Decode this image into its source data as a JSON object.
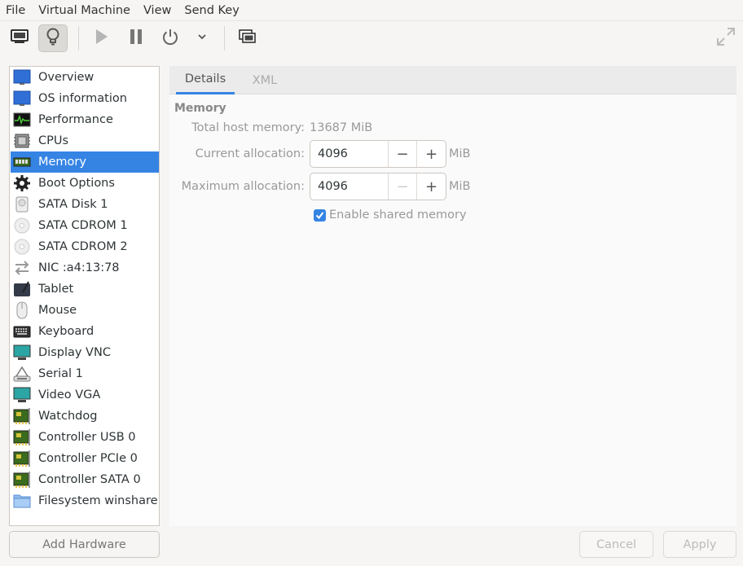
{
  "menubar": {
    "items": [
      "File",
      "Virtual Machine",
      "View",
      "Send Key"
    ]
  },
  "toolbar": {
    "console_icon": "monitor-icon",
    "details_icon": "lightbulb-icon",
    "run_icon": "play-icon",
    "pause_icon": "pause-icon",
    "shutdown_icon": "power-icon",
    "shutdown_menu_icon": "chevron-down-icon",
    "snapshots_icon": "snapshots-icon",
    "fullscreen_icon": "fullscreen-icon"
  },
  "sidebar": {
    "selected_index": 4,
    "items": [
      {
        "label": "Overview",
        "icon": "monitor-blue-icon"
      },
      {
        "label": "OS information",
        "icon": "monitor-blue-icon"
      },
      {
        "label": "Performance",
        "icon": "performance-graph-icon"
      },
      {
        "label": "CPUs",
        "icon": "cpu-chip-icon"
      },
      {
        "label": "Memory",
        "icon": "memory-module-icon"
      },
      {
        "label": "Boot Options",
        "icon": "gear-icon"
      },
      {
        "label": "SATA Disk 1",
        "icon": "hard-disk-icon"
      },
      {
        "label": "SATA CDROM 1",
        "icon": "cdrom-icon"
      },
      {
        "label": "SATA CDROM 2",
        "icon": "cdrom-icon"
      },
      {
        "label": "NIC :a4:13:78",
        "icon": "network-arrows-icon"
      },
      {
        "label": "Tablet",
        "icon": "tablet-icon"
      },
      {
        "label": "Mouse",
        "icon": "mouse-icon"
      },
      {
        "label": "Keyboard",
        "icon": "keyboard-icon"
      },
      {
        "label": "Display VNC",
        "icon": "display-icon"
      },
      {
        "label": "Serial 1",
        "icon": "serial-icon"
      },
      {
        "label": "Video VGA",
        "icon": "display-icon"
      },
      {
        "label": "Watchdog",
        "icon": "pci-card-icon"
      },
      {
        "label": "Controller USB 0",
        "icon": "pci-card-icon"
      },
      {
        "label": "Controller PCIe 0",
        "icon": "pci-card-icon"
      },
      {
        "label": "Controller SATA 0",
        "icon": "pci-card-icon"
      },
      {
        "label": "Filesystem winshare",
        "icon": "folder-icon"
      }
    ],
    "add_hardware_label": "Add Hardware"
  },
  "tabs": [
    {
      "label": "Details",
      "active": true
    },
    {
      "label": "XML",
      "active": false
    }
  ],
  "memory": {
    "section_title": "Memory",
    "total_label": "Total host memory:",
    "total_value": "13687 MiB",
    "current_label": "Current allocation:",
    "current_value": "4096",
    "current_unit": "MiB",
    "max_label": "Maximum allocation:",
    "max_value": "4096",
    "max_unit": "MiB",
    "shared_label": "Enable shared memory",
    "shared_checked": true
  },
  "footer": {
    "cancel_label": "Cancel",
    "apply_label": "Apply"
  },
  "colors": {
    "accent": "#3584e4",
    "window_bg": "#f6f5f4"
  }
}
